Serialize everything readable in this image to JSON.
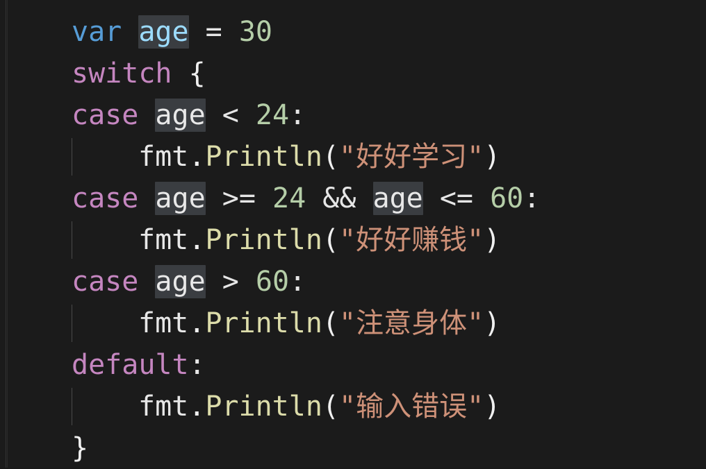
{
  "editor": {
    "theme": "dark-plus",
    "language": "go",
    "background_color": "#1b1b1b",
    "highlight_color": "#3a3d41",
    "indent_guide_color": "#4a4a4a",
    "colors": {
      "keyword_control": "#c586c0",
      "keyword_var": "#569cd6",
      "identifier": "#9cdcfe",
      "number": "#b5cea8",
      "operator": "#e6e6e6",
      "punctuation": "#f0f0f0",
      "function": "#dcdcaa",
      "package": "#e8e8e8",
      "string": "#ce9178"
    }
  },
  "code": {
    "lines": [
      {
        "n": 1,
        "indent": 0,
        "text": "var age = 30",
        "tokens": [
          {
            "t": "var",
            "c": "kw-var"
          },
          {
            "t": " ",
            "c": "op"
          },
          {
            "t": "age",
            "c": "ident",
            "hl": true
          },
          {
            "t": " = ",
            "c": "op"
          },
          {
            "t": "30",
            "c": "num"
          }
        ]
      },
      {
        "n": 2,
        "indent": 0,
        "text": "switch {",
        "tokens": [
          {
            "t": "switch",
            "c": "kw"
          },
          {
            "t": " ",
            "c": "op"
          },
          {
            "t": "{",
            "c": "punct"
          }
        ]
      },
      {
        "n": 3,
        "indent": 0,
        "text": "case age < 24:",
        "tokens": [
          {
            "t": "case",
            "c": "kw"
          },
          {
            "t": " ",
            "c": "op"
          },
          {
            "t": "age",
            "c": "ident-w",
            "hl": true
          },
          {
            "t": " < ",
            "c": "op"
          },
          {
            "t": "24",
            "c": "num"
          },
          {
            "t": ":",
            "c": "op"
          }
        ]
      },
      {
        "n": 4,
        "indent": 1,
        "text": "fmt.Println(\"好好学习\")",
        "tokens": [
          {
            "t": "fmt",
            "c": "pkg"
          },
          {
            "t": ".",
            "c": "punct"
          },
          {
            "t": "Println",
            "c": "fn"
          },
          {
            "t": "(",
            "c": "punct"
          },
          {
            "t": "\"好好学习\"",
            "c": "str"
          },
          {
            "t": ")",
            "c": "punct"
          }
        ]
      },
      {
        "n": 5,
        "indent": 0,
        "text": "case age >= 24 && age <= 60:",
        "tokens": [
          {
            "t": "case",
            "c": "kw"
          },
          {
            "t": " ",
            "c": "op"
          },
          {
            "t": "age",
            "c": "ident-w",
            "hl": true
          },
          {
            "t": " >= ",
            "c": "op"
          },
          {
            "t": "24",
            "c": "num"
          },
          {
            "t": " && ",
            "c": "op"
          },
          {
            "t": "age",
            "c": "ident-w",
            "hl": true
          },
          {
            "t": " <= ",
            "c": "op"
          },
          {
            "t": "60",
            "c": "num"
          },
          {
            "t": ":",
            "c": "op"
          }
        ]
      },
      {
        "n": 6,
        "indent": 1,
        "text": "fmt.Println(\"好好赚钱\")",
        "tokens": [
          {
            "t": "fmt",
            "c": "pkg"
          },
          {
            "t": ".",
            "c": "punct"
          },
          {
            "t": "Println",
            "c": "fn"
          },
          {
            "t": "(",
            "c": "punct"
          },
          {
            "t": "\"好好赚钱\"",
            "c": "str"
          },
          {
            "t": ")",
            "c": "punct"
          }
        ]
      },
      {
        "n": 7,
        "indent": 0,
        "text": "case age > 60:",
        "tokens": [
          {
            "t": "case",
            "c": "kw"
          },
          {
            "t": " ",
            "c": "op"
          },
          {
            "t": "age",
            "c": "ident-w",
            "hl": true
          },
          {
            "t": " > ",
            "c": "op"
          },
          {
            "t": "60",
            "c": "num"
          },
          {
            "t": ":",
            "c": "op"
          }
        ]
      },
      {
        "n": 8,
        "indent": 1,
        "text": "fmt.Println(\"注意身体\")",
        "tokens": [
          {
            "t": "fmt",
            "c": "pkg"
          },
          {
            "t": ".",
            "c": "punct"
          },
          {
            "t": "Println",
            "c": "fn"
          },
          {
            "t": "(",
            "c": "punct"
          },
          {
            "t": "\"注意身体\"",
            "c": "str"
          },
          {
            "t": ")",
            "c": "punct"
          }
        ]
      },
      {
        "n": 9,
        "indent": 0,
        "text": "default:",
        "tokens": [
          {
            "t": "default",
            "c": "kw"
          },
          {
            "t": ":",
            "c": "op"
          }
        ]
      },
      {
        "n": 10,
        "indent": 1,
        "text": "fmt.Println(\"输入错误\")",
        "tokens": [
          {
            "t": "fmt",
            "c": "pkg"
          },
          {
            "t": ".",
            "c": "punct"
          },
          {
            "t": "Println",
            "c": "fn"
          },
          {
            "t": "(",
            "c": "punct"
          },
          {
            "t": "\"输入错误\"",
            "c": "str"
          },
          {
            "t": ")",
            "c": "punct"
          }
        ]
      },
      {
        "n": 11,
        "indent": 0,
        "text": "}",
        "tokens": [
          {
            "t": "}",
            "c": "punct"
          }
        ]
      }
    ]
  }
}
